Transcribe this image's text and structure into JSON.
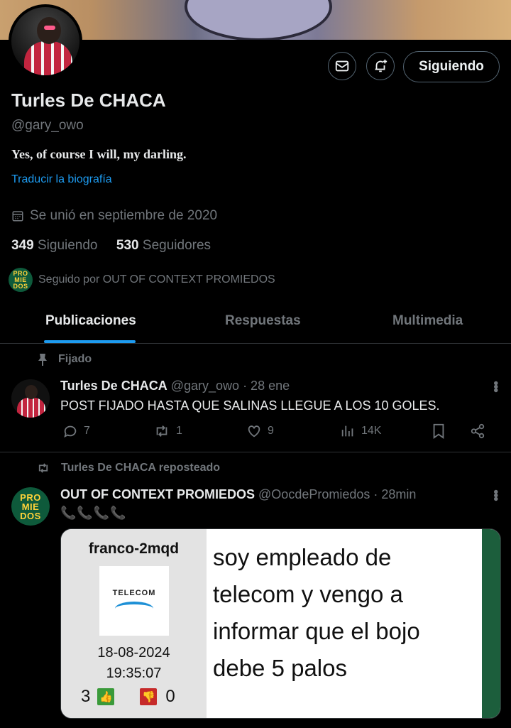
{
  "profile": {
    "name": "Turles De CHACA",
    "handle": "@gary_owo",
    "bio": "Yes, of course I will, my darling.",
    "translate_bio": "Traducir la biografía",
    "joined": "Se unió en septiembre de 2020",
    "following_count": "349",
    "following_label": "Siguiendo",
    "followers_count": "530",
    "followers_label": "Seguidores",
    "followed_by": "Seguido por OUT OF CONTEXT PROMIEDOS",
    "follow_button": "Siguiendo"
  },
  "promiedos_logo": [
    "PRO",
    "MIE",
    "DOS"
  ],
  "tabs": [
    {
      "label": "Publicaciones",
      "active": true
    },
    {
      "label": "Respuestas",
      "active": false
    },
    {
      "label": "Multimedia",
      "active": false
    }
  ],
  "pinned_tweet": {
    "context": "Fijado",
    "author": "Turles De CHACA",
    "handle": "@gary_owo",
    "time": "· 28 ene",
    "text": "POST FIJADO HASTA QUE SALINAS LLEGUE A LOS 10 GOLES.",
    "replies": "7",
    "reposts": "1",
    "likes": "9",
    "views": "14K"
  },
  "repost_tweet": {
    "context": "Turles De CHACA reposteado",
    "author": "OUT OF CONTEXT PROMIEDOS",
    "handle": "@OocdePromiedos",
    "time": "· 28min",
    "text": "📞📞📞📞",
    "media": {
      "username": "franco-2mqd",
      "logo_text": "TELECOM",
      "date": "18-08-2024",
      "time": "19:35:07",
      "upvotes": "3",
      "downvotes": "0",
      "body": "soy empleado de telecom y vengo a informar que el bojo debe 5 palos"
    }
  },
  "colors": {
    "accent": "#1d9bf0",
    "muted": "#71767b",
    "text": "#e7e9ea",
    "border": "#2f3336"
  }
}
